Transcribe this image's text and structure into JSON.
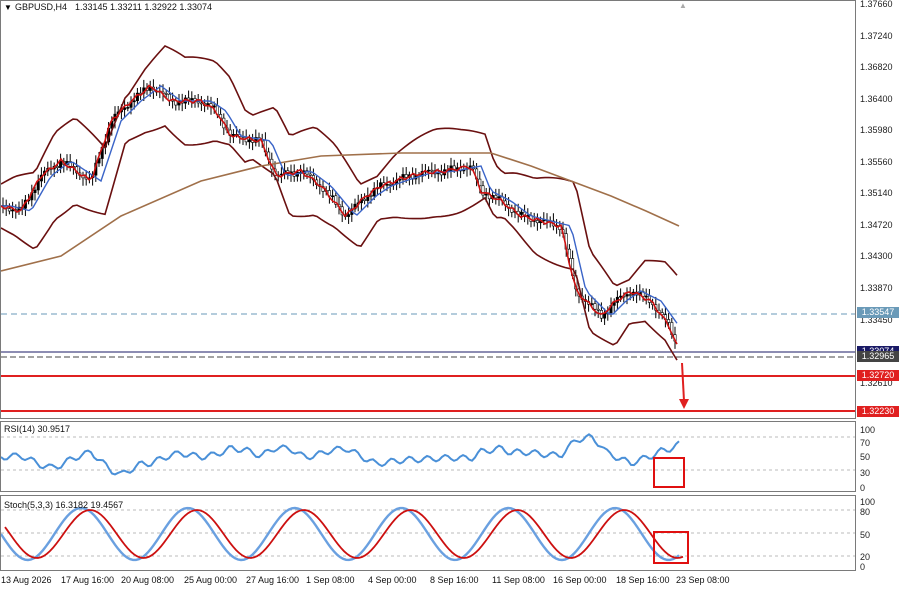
{
  "header": {
    "symbol": "GBPUSD,H4",
    "quote": "1.33145 1.33211 1.32922 1.33074"
  },
  "price_axis": {
    "ticks": [
      "1.37660",
      "1.37240",
      "1.36820",
      "1.36400",
      "1.35980",
      "1.35560",
      "1.35140",
      "1.34720",
      "1.34300",
      "1.33870",
      "1.33450",
      "1.32610"
    ]
  },
  "price_tags": [
    {
      "value": "1.33547",
      "color": "#6a9ab8"
    },
    {
      "value": "1.33074",
      "color": "#1a1a66"
    },
    {
      "value": "1.32965",
      "color": "#444444"
    },
    {
      "value": "1.32720",
      "color": "#e02020"
    },
    {
      "value": "1.32230",
      "color": "#e02020"
    }
  ],
  "rsi": {
    "label": "RSI(14) 30.9517",
    "ticks": [
      "100",
      "70",
      "50",
      "30",
      "0"
    ]
  },
  "stoch": {
    "label": "Stoch(5,3,3) 16.3182 19.4567",
    "ticks": [
      "100",
      "80",
      "50",
      "20",
      "0"
    ]
  },
  "dates": [
    "13 Aug 2026",
    "17 Aug 16:00",
    "20 Aug 08:00",
    "25 Aug 00:00",
    "27 Aug 16:00",
    "1 Sep 08:00",
    "4 Sep 00:00",
    "8 Sep 16:00",
    "11 Sep 08:00",
    "16 Sep 00:00",
    "18 Sep 16:00",
    "23 Sep 08:00"
  ],
  "colors": {
    "up": "#000000",
    "ma_red": "#cc1010",
    "ma_blue": "#3a64c8",
    "ma_brown": "#a0704a",
    "bands": "#6a1010",
    "rsi": "#4a90d8",
    "stoch_main": "#6aa0e0",
    "stoch_signal": "#cc1010",
    "level": "#e02020"
  }
}
